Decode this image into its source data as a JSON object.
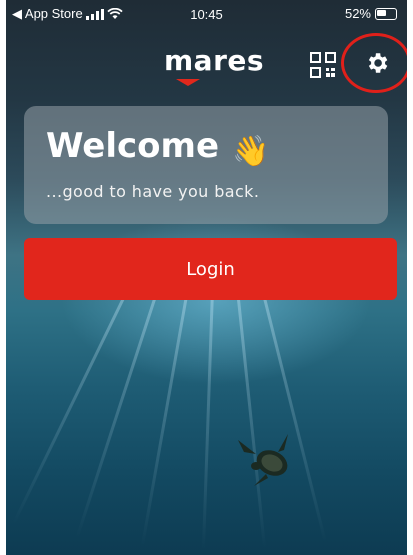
{
  "status_bar": {
    "back_app": "◀ App Store",
    "time": "10:45",
    "battery": "52%"
  },
  "header": {
    "logo": "mares",
    "qr_icon": "qr-code-icon",
    "settings_icon": "gear-icon",
    "highlight_color": "#e0201a"
  },
  "welcome": {
    "title": "Welcome",
    "emoji": "👋",
    "subtitle": "...good to have you back."
  },
  "login": {
    "label": "Login",
    "color": "#e1261c"
  }
}
